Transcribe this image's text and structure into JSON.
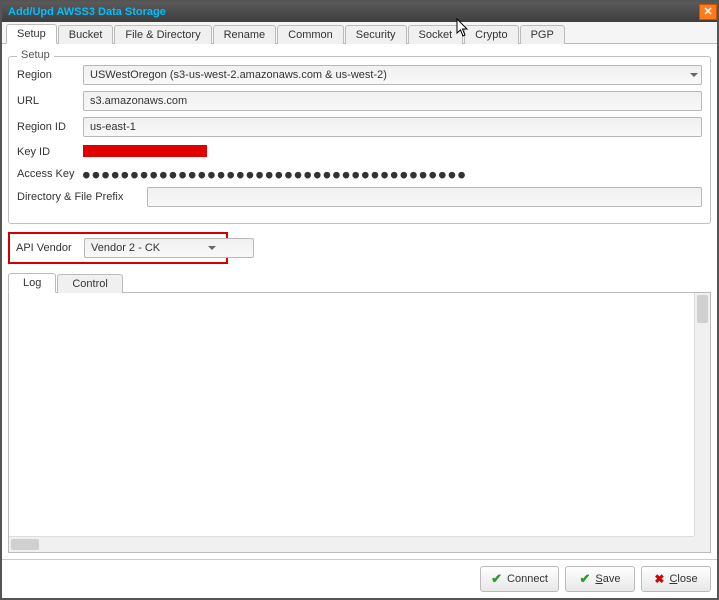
{
  "window": {
    "title": "Add/Upd AWSS3 Data Storage"
  },
  "tabs": {
    "items": [
      {
        "label": "Setup",
        "active": true
      },
      {
        "label": "Bucket"
      },
      {
        "label": "File & Directory"
      },
      {
        "label": "Rename"
      },
      {
        "label": "Common"
      },
      {
        "label": "Security"
      },
      {
        "label": "Socket"
      },
      {
        "label": "Crypto"
      },
      {
        "label": "PGP"
      }
    ]
  },
  "setup": {
    "legend": "Setup",
    "region_label": "Region",
    "region_value": "USWestOregon (s3-us-west-2.amazonaws.com & us-west-2)",
    "url_label": "URL",
    "url_value": "s3.amazonaws.com",
    "region_id_label": "Region ID",
    "region_id_value": "us-east-1",
    "key_id_label": "Key ID",
    "access_key_label": "Access Key",
    "access_key_value": "●●●●●●●●●●●●●●●●●●●●●●●●●●●●●●●●●●●●●●●●",
    "prefix_label": "Directory & File Prefix",
    "prefix_value": "",
    "api_vendor_label": "API Vendor",
    "api_vendor_value": "Vendor 2 - CK"
  },
  "lower_tabs": {
    "items": [
      {
        "label": "Log",
        "active": true
      },
      {
        "label": "Control"
      }
    ]
  },
  "footer": {
    "connect": "Connect",
    "save": "Save",
    "close": "Close"
  }
}
